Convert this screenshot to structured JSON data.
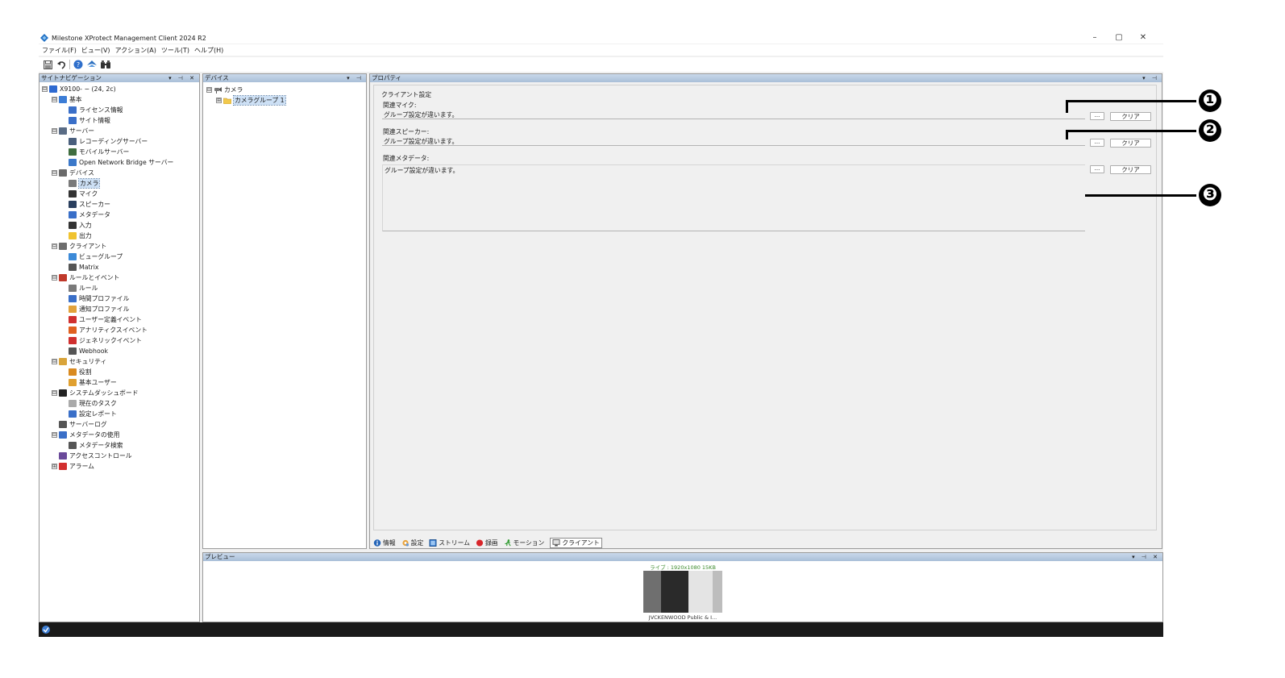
{
  "window": {
    "title": "Milestone XProtect Management Client 2024 R2",
    "minimize": "–",
    "restore": "▢",
    "close": "✕"
  },
  "menu": [
    "ファイル(F)",
    "ビュー(V)",
    "アクション(A)",
    "ツール(T)",
    "ヘルプ(H)"
  ],
  "toolbar": {
    "icons": [
      "save-icon",
      "undo-icon",
      "help-icon",
      "connect-icon",
      "find-icon"
    ]
  },
  "nav": {
    "title": "サイトナビゲーション",
    "controls": "▾ ⊣ ✕",
    "items": [
      {
        "label": "X9100-            − (24, 2c)",
        "toggle": "⊟"
      },
      {
        "label": "基本",
        "toggle": "⊟"
      },
      {
        "label": "ライセンス情報",
        "toggle": ""
      },
      {
        "label": "サイト情報",
        "toggle": ""
      },
      {
        "label": "サーバー",
        "toggle": "⊟"
      },
      {
        "label": "レコーディングサーバー",
        "toggle": ""
      },
      {
        "label": "モバイルサーバー",
        "toggle": ""
      },
      {
        "label": "Open Network Bridge サーバー",
        "toggle": ""
      },
      {
        "label": "デバイス",
        "toggle": "⊟"
      },
      {
        "label": "カメラ",
        "toggle": ""
      },
      {
        "label": "マイク",
        "toggle": ""
      },
      {
        "label": "スピーカー",
        "toggle": ""
      },
      {
        "label": "メタデータ",
        "toggle": ""
      },
      {
        "label": "入力",
        "toggle": ""
      },
      {
        "label": "出力",
        "toggle": ""
      },
      {
        "label": "クライアント",
        "toggle": "⊟"
      },
      {
        "label": "ビューグループ",
        "toggle": ""
      },
      {
        "label": "Matrix",
        "toggle": ""
      },
      {
        "label": "ルールとイベント",
        "toggle": "⊟"
      },
      {
        "label": "ルール",
        "toggle": ""
      },
      {
        "label": "時間プロファイル",
        "toggle": ""
      },
      {
        "label": "通知プロファイル",
        "toggle": ""
      },
      {
        "label": "ユーザー定義イベント",
        "toggle": ""
      },
      {
        "label": "アナリティクスイベント",
        "toggle": ""
      },
      {
        "label": "ジェネリックイベント",
        "toggle": ""
      },
      {
        "label": "Webhook",
        "toggle": ""
      },
      {
        "label": "セキュリティ",
        "toggle": "⊟"
      },
      {
        "label": "役割",
        "toggle": ""
      },
      {
        "label": "基本ユーザー",
        "toggle": ""
      },
      {
        "label": "システムダッシュボード",
        "toggle": "⊟"
      },
      {
        "label": "現在のタスク",
        "toggle": ""
      },
      {
        "label": "設定レポート",
        "toggle": ""
      },
      {
        "label": "サーバーログ",
        "toggle": ""
      },
      {
        "label": "メタデータの使用",
        "toggle": "⊟"
      },
      {
        "label": "メタデータ検索",
        "toggle": ""
      },
      {
        "label": "アクセスコントロール",
        "toggle": ""
      },
      {
        "label": "アラーム",
        "toggle": "⊞"
      }
    ]
  },
  "devices": {
    "title": "デバイス",
    "controls": "▾ ⊣",
    "root": "カメラ",
    "root_toggle": "⊟",
    "group": "カメラグループ 1",
    "group_toggle": "⊞"
  },
  "properties": {
    "title": "プロパティ",
    "controls": "▾ ⊣",
    "section": "クライアント設定",
    "mic_label": "関連マイク:",
    "mic_value": "グループ設定が違います。",
    "speaker_label": "関連スピーカー:",
    "speaker_value": "グループ設定が違います。",
    "metadata_label": "関連メタデータ:",
    "metadata_value": "グループ設定が違います。",
    "dots": "...",
    "clear": "クリア",
    "tabs": [
      {
        "label": "情報",
        "icon": "info-icon"
      },
      {
        "label": "設定",
        "icon": "settings-icon"
      },
      {
        "label": "ストリーム",
        "icon": "stream-icon"
      },
      {
        "label": "録画",
        "icon": "record-icon"
      },
      {
        "label": "モーション",
        "icon": "motion-icon"
      },
      {
        "label": "クライアント",
        "icon": "client-icon"
      }
    ],
    "active_tab": "クライアント"
  },
  "preview": {
    "title": "プレビュー",
    "controls": "▾ ⊣ ✕",
    "live_caption": "ライブ : 1920x1080 15KB",
    "camera_name": "JVCKENWOOD Public & I..."
  },
  "callouts": [
    "❶",
    "❷",
    "❸"
  ]
}
